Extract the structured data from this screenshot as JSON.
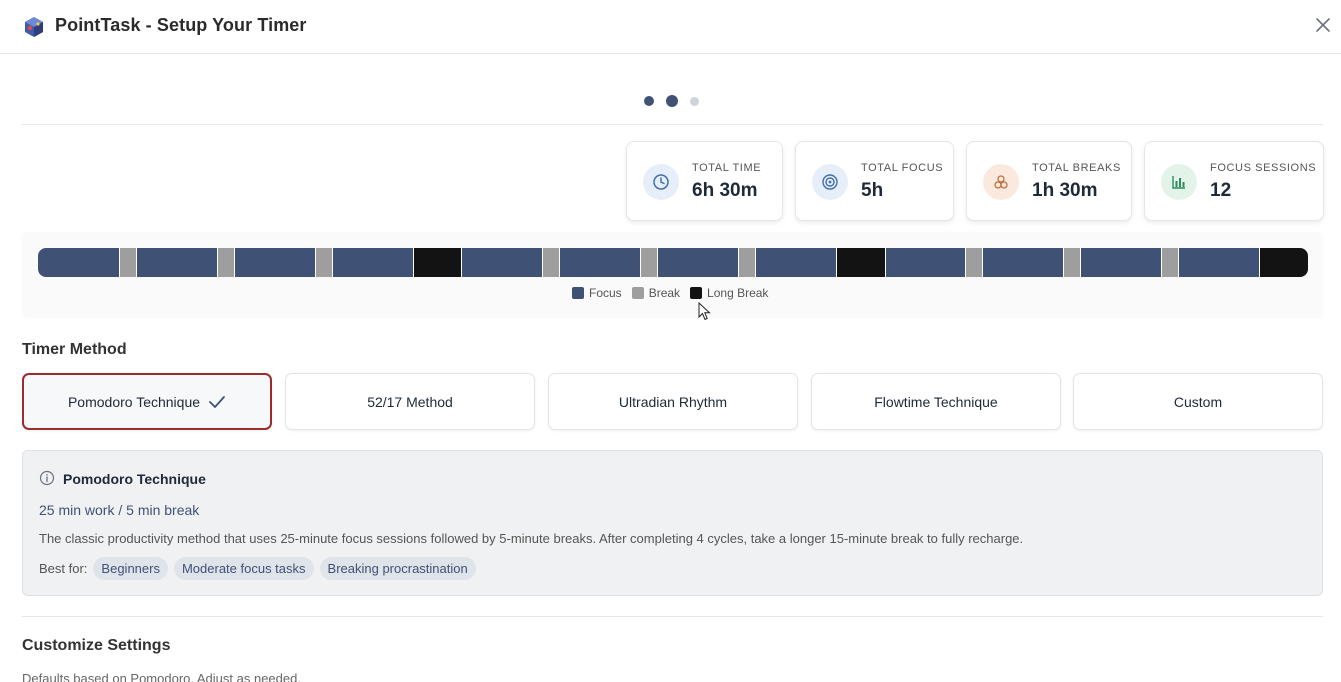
{
  "window": {
    "title": "PointTask - Setup Your Timer",
    "app_icon": "pointtask-logo-icon",
    "close_icon": "close-icon"
  },
  "pagination": {
    "total": 3,
    "active": 2
  },
  "stats": [
    {
      "label": "TOTAL TIME",
      "value": "6h 30m",
      "icon": "clock-icon",
      "color": "#3f6fae"
    },
    {
      "label": "TOTAL FOCUS",
      "value": "5h",
      "icon": "target-icon",
      "color": "#3f6fae"
    },
    {
      "label": "TOTAL BREAKS",
      "value": "1h 30m",
      "icon": "coffee-icon",
      "color": "#c0703d"
    },
    {
      "label": "FOCUS SESSIONS",
      "value": "12",
      "icon": "bar-chart-icon",
      "color": "#2f8a5c"
    }
  ],
  "timeline": {
    "segments": [
      "focus",
      "break",
      "focus",
      "break",
      "focus",
      "break",
      "focus",
      "long",
      "focus",
      "break",
      "focus",
      "break",
      "focus",
      "break",
      "focus",
      "long",
      "focus",
      "break",
      "focus",
      "break",
      "focus",
      "break",
      "focus",
      "long"
    ],
    "colors": {
      "focus": "#3f5275",
      "break": "#9e9e9e",
      "long": "#131313"
    }
  },
  "legend": {
    "focus": "Focus",
    "break": "Break",
    "long": "Long Break"
  },
  "timer_method": {
    "heading": "Timer Method",
    "options": [
      "Pomodoro Technique",
      "52/17 Method",
      "Ultradian Rhythm",
      "Flowtime Technique",
      "Custom"
    ],
    "selected": "Pomodoro Technique"
  },
  "info": {
    "title": "Pomodoro Technique",
    "subtitle": "25 min work / 5 min break",
    "description": "The classic productivity method that uses 25-minute focus sessions followed by 5-minute breaks. After completing 4 cycles, take a longer 15-minute break to fully recharge.",
    "best_for_label": "Best for:",
    "tags": [
      "Beginners",
      "Moderate focus tasks",
      "Breaking procrastination"
    ]
  },
  "customize": {
    "heading": "Customize Settings",
    "subtitle": "Defaults based on Pomodoro. Adjust as needed."
  },
  "accent": "#9b2c2c"
}
